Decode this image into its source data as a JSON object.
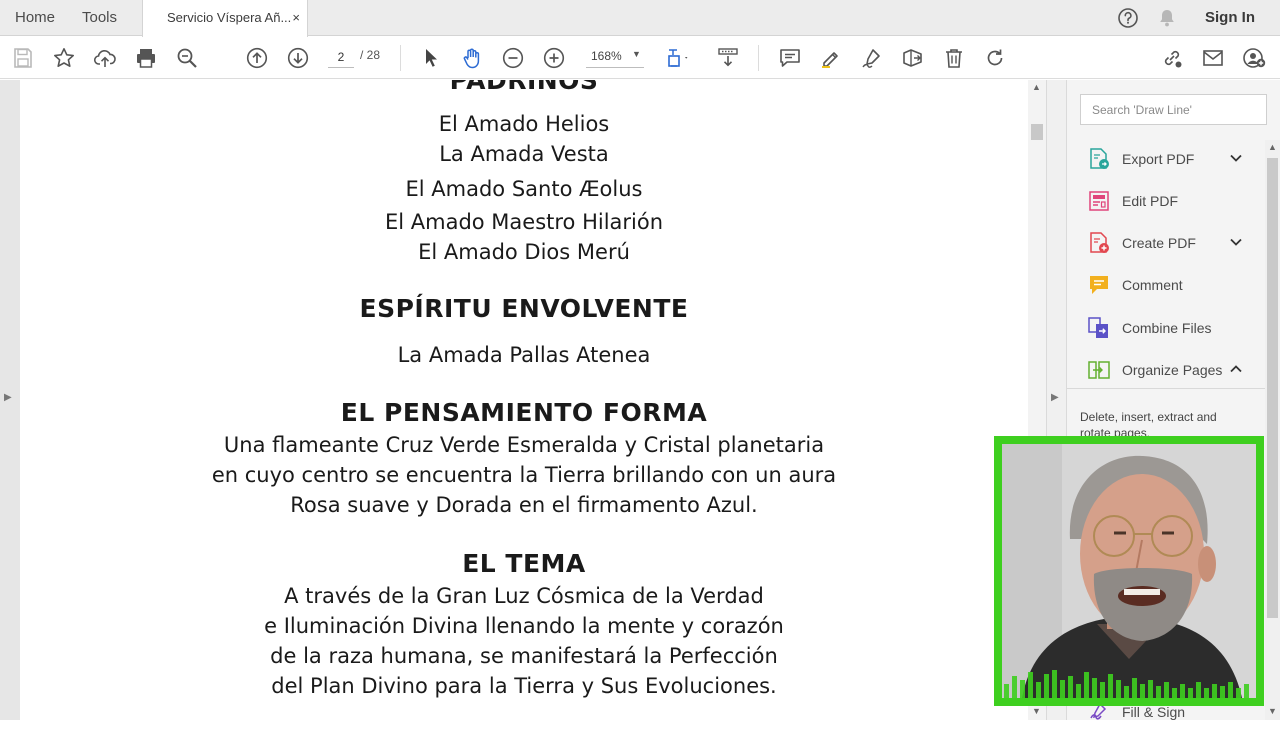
{
  "tabs": {
    "home": "Home",
    "tools": "Tools",
    "document": "Servicio Víspera Añ...",
    "close": "×"
  },
  "header": {
    "sign_in": "Sign In",
    "icons": [
      "help-icon",
      "bell-icon"
    ]
  },
  "toolbar": {
    "page_current": "2",
    "page_total": "/ 28",
    "zoom": "168%",
    "icons": [
      "save-icon",
      "star-icon",
      "cloud-upload-icon",
      "print-icon",
      "search-zoom-icon",
      "page-up-icon",
      "page-down-icon",
      "select-cursor-icon",
      "hand-icon",
      "zoom-out-icon",
      "zoom-in-icon",
      "fit-page-icon",
      "scroll-mode-icon",
      "comment-icon",
      "highlight-pen-icon",
      "sign-icon",
      "stamp-icon",
      "delete-icon",
      "rotate-icon",
      "share-link-icon",
      "email-icon",
      "add-user-icon"
    ]
  },
  "document": {
    "lines": [
      "PADRINOS",
      "El Amado Helios",
      "La Amada Vesta",
      "El Amado Santo Æolus",
      "El Amado Maestro Hilarión",
      "El Amado Dios Merú",
      "ESPÍRITU ENVOLVENTE",
      "La Amada Pallas Atenea",
      "EL PENSAMIENTO FORMA",
      "Una flameante Cruz Verde Esmeralda y Cristal planetaria",
      "en cuyo centro se encuentra la Tierra brillando con un aura",
      "Rosa suave y Dorada en el firmamento Azul.",
      "EL TEMA",
      "A través de la Gran Luz Cósmica de la Verdad",
      "e Iluminación Divina llenando la mente y corazón",
      "de la raza humana, se manifestará la Perfección",
      "del Plan Divino para la Tierra y Sus Evoluciones."
    ]
  },
  "right_panel": {
    "search_placeholder": "Search 'Draw Line'",
    "tools": [
      {
        "label": "Export PDF",
        "icon": "export-pdf-icon",
        "color": "#2aa59b"
      },
      {
        "label": "Edit PDF",
        "icon": "edit-pdf-icon",
        "color": "#e0457b"
      },
      {
        "label": "Create PDF",
        "icon": "create-pdf-icon",
        "color": "#e2474f"
      },
      {
        "label": "Comment",
        "icon": "comment-tool-icon",
        "color": "#f2b01e"
      },
      {
        "label": "Combine Files",
        "icon": "combine-files-icon",
        "color": "#5b52c7"
      },
      {
        "label": "Organize Pages",
        "icon": "organize-pages-icon",
        "color": "#63b030"
      }
    ],
    "organize_description": "Delete, insert, extract and rotate pages.",
    "fill_sign": "Fill & Sign"
  },
  "colors": {
    "webcam_border": "#3ecf1f",
    "accent": "#2d6bd3"
  }
}
